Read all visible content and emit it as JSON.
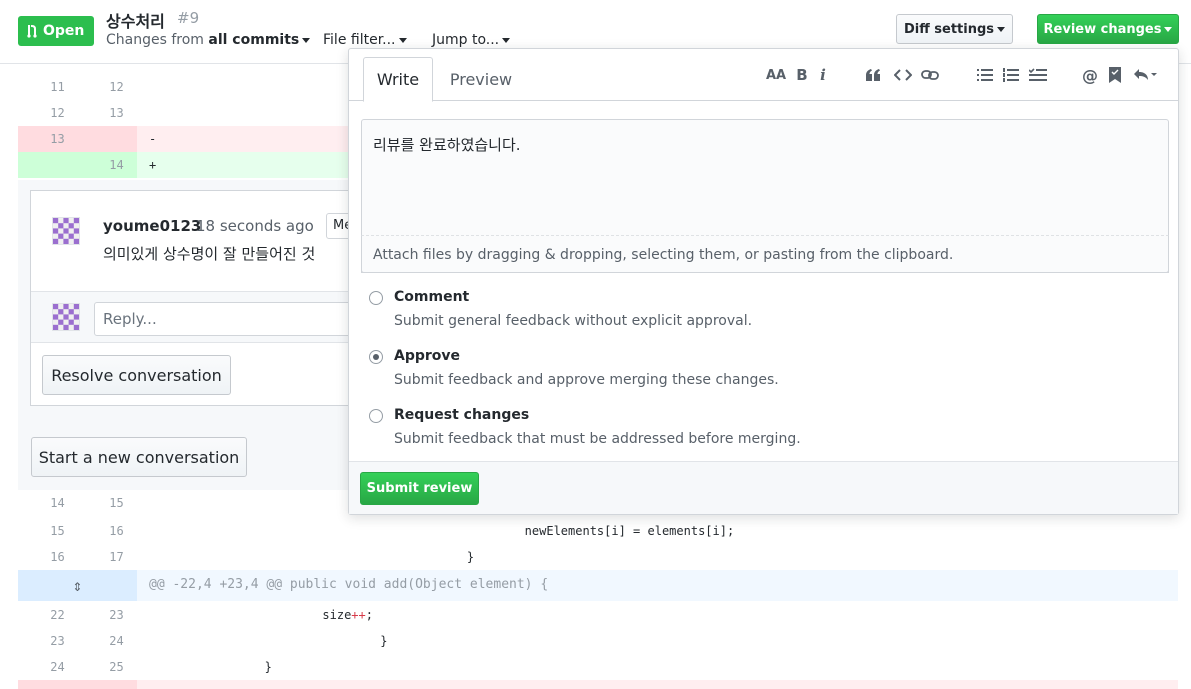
{
  "header": {
    "state_label": "Open",
    "title": "상수처리",
    "number": "#9",
    "changes_from_prefix": "Changes from",
    "changes_from_value": "all commits",
    "file_filter_label": "File filter...",
    "jump_to_label": "Jump to...",
    "diff_settings_label": "Diff settings",
    "review_changes_label": "Review changes"
  },
  "diff_top": [
    {
      "old": "11",
      "new": "12",
      "code": "",
      "type": "ctx"
    },
    {
      "old": "12",
      "new": "13",
      "code": "",
      "type": "ctx"
    },
    {
      "old": "13",
      "new": "",
      "code": "-",
      "type": "del"
    },
    {
      "old": "",
      "new": "14",
      "code": "+",
      "type": "add"
    }
  ],
  "thread": {
    "author": "youme0123",
    "time": "18 seconds ago",
    "badge": "Me",
    "comment": "의미있게 상수명이 잘 만들어진 것",
    "reply_placeholder": "Reply...",
    "resolve_label": "Resolve conversation",
    "start_new_label": "Start a new conversation"
  },
  "diff_bottom": [
    {
      "old": "14",
      "new": "15",
      "code": "",
      "type": "ctx"
    },
    {
      "old": "15",
      "new": "16",
      "code": "                                                    newElements[i] = elements[i];",
      "type": "ctx"
    },
    {
      "old": "16",
      "new": "17",
      "code": "                                            }",
      "type": "ctx"
    }
  ],
  "hunk_header": "@@ -22,4 +23,4 @@ public void add(Object element) {",
  "diff_after_hunk": [
    {
      "old": "22",
      "new": "23",
      "code_pre": "                        size",
      "code_op": "++",
      "code_post": ";",
      "type": "ctx"
    },
    {
      "old": "23",
      "new": "24",
      "code": "                                }",
      "type": "ctx"
    },
    {
      "old": "24",
      "new": "25",
      "code": "                }",
      "type": "ctx"
    }
  ],
  "review": {
    "tab_write": "Write",
    "tab_preview": "Preview",
    "toolbar": {
      "heading": "AA",
      "bold": "B",
      "italic": "i"
    },
    "body_text": "리뷰를 완료하였습니다.",
    "attach_hint": "Attach files by dragging & dropping, selecting them, or pasting from the clipboard.",
    "options": [
      {
        "label": "Comment",
        "desc": "Submit general feedback without explicit approval.",
        "selected": false
      },
      {
        "label": "Approve",
        "desc": "Submit feedback and approve merging these changes.",
        "selected": true
      },
      {
        "label": "Request changes",
        "desc": "Submit feedback that must be addressed before merging.",
        "selected": false
      }
    ],
    "submit_label": "Submit review"
  },
  "colors": {
    "green": "#28a745",
    "deletion_bg": "#ffeef0",
    "addition_bg": "#e6ffed",
    "hunk_bg": "#f1f8ff"
  }
}
